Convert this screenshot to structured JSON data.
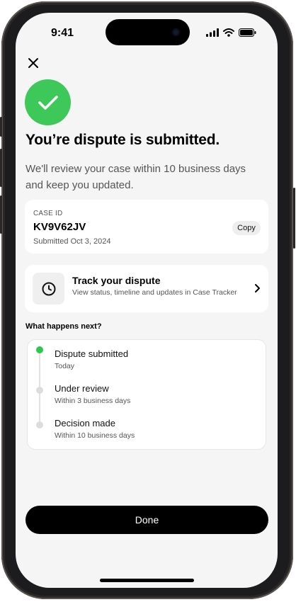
{
  "status_bar": {
    "time": "9:41"
  },
  "header": {
    "title": "You’re dispute is submitted.",
    "subtitle": "We'll review your case within 10 business days and keep you updated."
  },
  "case": {
    "label": "CASE ID",
    "id": "KV9V62JV",
    "submitted": "Submitted Oct 3, 2024",
    "copy_label": "Copy"
  },
  "track": {
    "title": "Track your dispute",
    "description": "View status, timeline and updates in Case Tracker"
  },
  "next": {
    "heading": "What happens next?",
    "steps": [
      {
        "title": "Dispute submitted",
        "sub": "Today",
        "active": true
      },
      {
        "title": "Under review",
        "sub": "Within 3 business days",
        "active": false
      },
      {
        "title": "Decision made",
        "sub": "Within 10 business days",
        "active": false
      }
    ]
  },
  "footer": {
    "done_label": "Done"
  },
  "colors": {
    "success": "#3ec85a",
    "active_dot": "#2ec84e",
    "inactive_dot": "#dcdcdc",
    "button": "#000000"
  },
  "icons": [
    "close-icon",
    "checkmark-icon",
    "clock-icon",
    "chevron-right-icon",
    "signal-icon",
    "wifi-icon",
    "battery-icon"
  ]
}
